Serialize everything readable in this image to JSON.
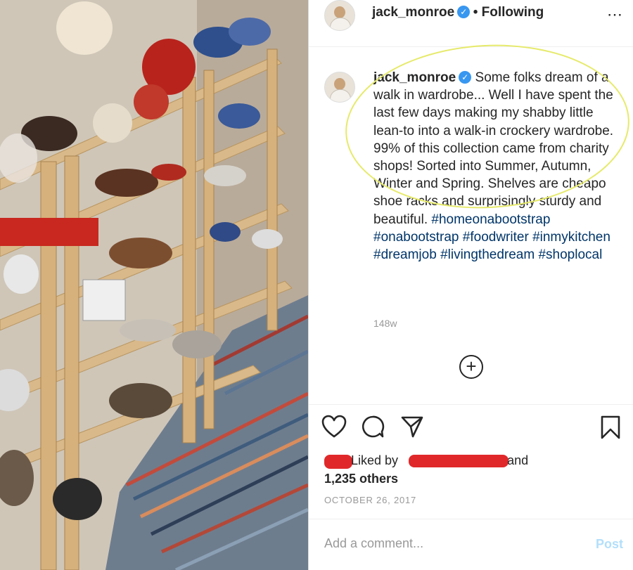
{
  "post": {
    "username": "jack_monroe",
    "follow_status": "• Following",
    "more_icon": "⋯",
    "caption_text": "Some folks dream of a walk in wardrobe... Well I have spent the last few days making my shabby little lean-to into a walk-in crockery wardrobe. 99% of this collection came from charity shops! Sorted into Summer, Autumn, Winter and Spring. Shelves are cheapo shoe racks and surprisingly sturdy and beautiful.",
    "hashtags": [
      "#homeonabootstrap",
      "#onabootstrap",
      "#foodwriter",
      "#inmykitchen",
      "#dreamjob",
      "#livingthedream",
      "#shoplocal"
    ],
    "relative_time": "148w",
    "load_more_icon": "+"
  },
  "engagement": {
    "liked_by_prefix": "Liked by",
    "liked_by_suffix": "and",
    "others_count": "1,235 others",
    "date": "OCTOBER 26, 2017"
  },
  "comment": {
    "placeholder": "Add a comment...",
    "post_label": "Post"
  },
  "colors": {
    "verified": "#3897f0",
    "hashtag": "#003569",
    "redaction": "#e0282a",
    "annotation_circle": "#e6ea6a",
    "post_button_disabled": "#b2dffc"
  },
  "icons": [
    "heart-icon",
    "comment-icon",
    "share-icon",
    "bookmark-icon",
    "plus-circle-icon",
    "verified-badge-icon",
    "more-options-icon"
  ]
}
